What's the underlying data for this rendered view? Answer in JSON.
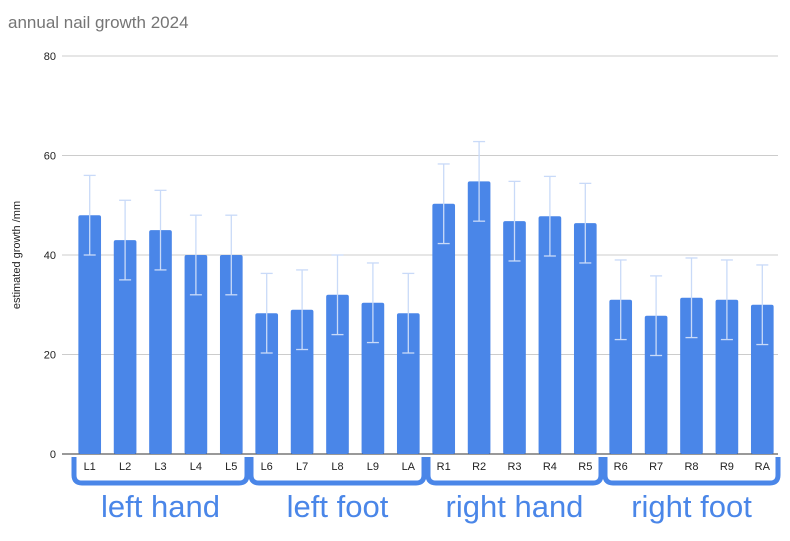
{
  "chart_data": {
    "type": "bar",
    "title": "annual nail growth 2024",
    "xlabel": "",
    "ylabel": "estimated growth /mm",
    "ylim": [
      0,
      80
    ],
    "yticks": [
      0,
      20,
      40,
      60,
      80
    ],
    "grid": true,
    "legend": "none",
    "bar_color": "#4a86e8",
    "error_bar_color": "#c9daf8",
    "categories": [
      "L1",
      "L2",
      "L3",
      "L4",
      "L5",
      "L6",
      "L7",
      "L8",
      "L9",
      "LA",
      "R1",
      "R2",
      "R3",
      "R4",
      "R5",
      "R6",
      "R7",
      "R8",
      "R9",
      "RA"
    ],
    "series": [
      {
        "name": "estimated growth /mm",
        "values": [
          48,
          43,
          45,
          40,
          40,
          28.3,
          29,
          32,
          30.4,
          28.3,
          50.3,
          54.8,
          46.8,
          47.8,
          46.4,
          31,
          27.8,
          31.4,
          31,
          30
        ],
        "error": 8
      }
    ],
    "groups": [
      {
        "label": "left hand",
        "from": 0,
        "to": 4
      },
      {
        "label": "left foot",
        "from": 5,
        "to": 9
      },
      {
        "label": "right hand",
        "from": 10,
        "to": 14
      },
      {
        "label": "right foot",
        "from": 15,
        "to": 19
      }
    ]
  }
}
